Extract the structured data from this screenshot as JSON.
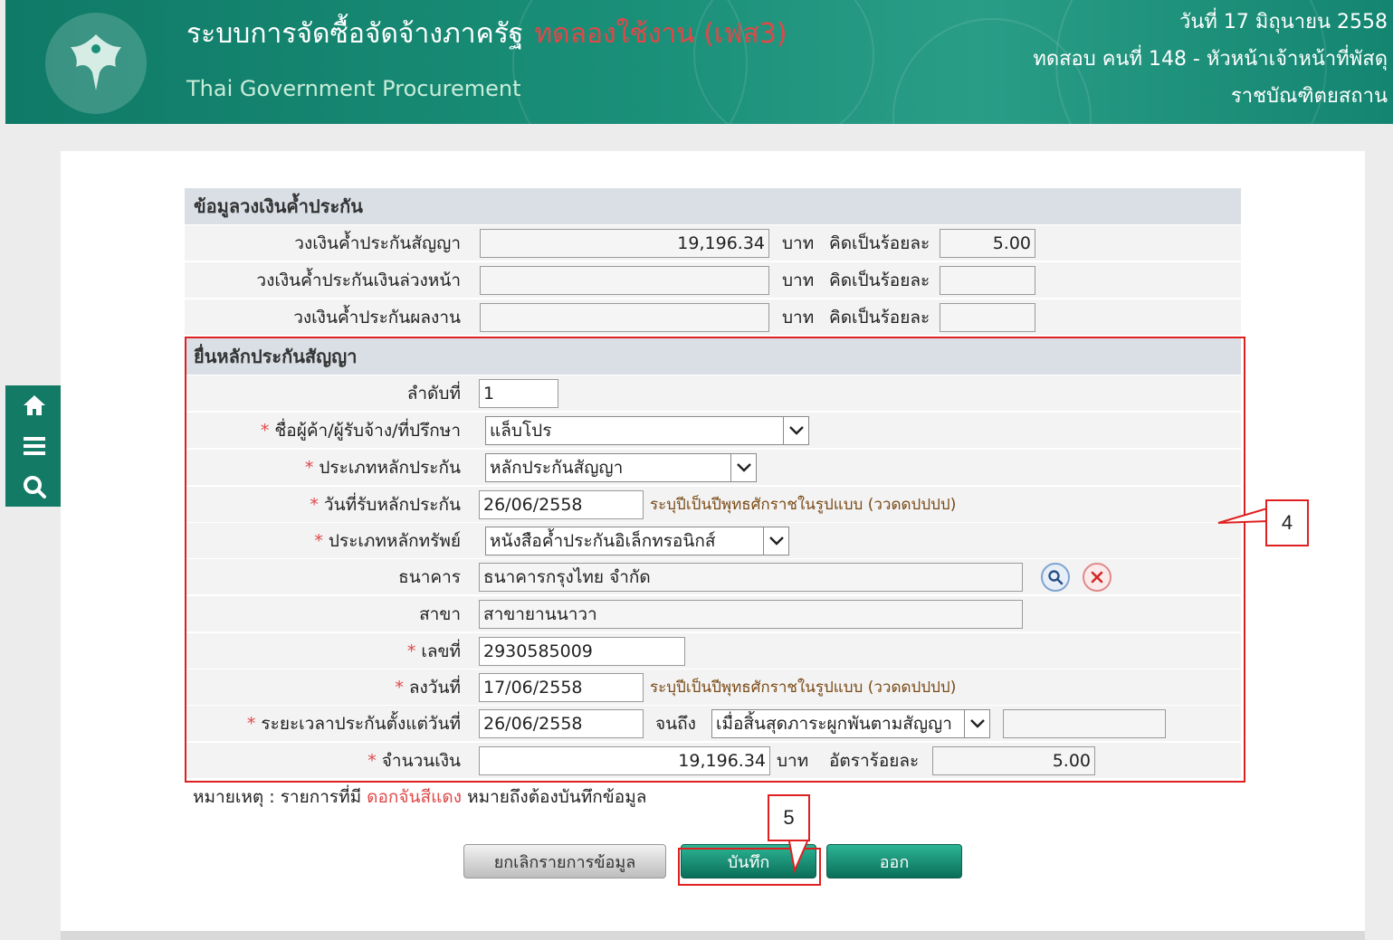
{
  "header": {
    "title": "ระบบการจัดซื้อจัดจ้างภาครัฐ",
    "trial_label": "ทดลองใช้งาน (เฟส3)",
    "subtitle": "Thai Government Procurement",
    "date": "วันที่ 17 มิถุนายน 2558",
    "user": "ทดสอบ คนที่ 148 - หัวหน้าเจ้าหน้าที่พัสดุ",
    "org": "ราชบัณฑิตยสถาน"
  },
  "sidebar": {
    "icons": [
      "home-icon",
      "menu-icon",
      "search-icon"
    ]
  },
  "guarantee_amounts": {
    "heading": "ข้อมูลวงเงินค้ำประกัน",
    "unit": "บาท",
    "percent_label": "คิดเป็นร้อยละ",
    "rows": [
      {
        "label": "วงเงินค้ำประกันสัญญา",
        "amount": "19,196.34",
        "percent": "5.00"
      },
      {
        "label": "วงเงินค้ำประกันเงินล่วงหน้า",
        "amount": "",
        "percent": ""
      },
      {
        "label": "วงเงินค้ำประกันผลงาน",
        "amount": "",
        "percent": ""
      }
    ]
  },
  "contract_guarantee": {
    "heading": "ยื่นหลักประกันสัญญา",
    "seq_label": "ลำดับที่",
    "seq_value": "1",
    "vendor_label": "ชื่อผู้ค้า/ผู้รับจ้าง/ที่ปรึกษา",
    "vendor_value": "แล็บโปร",
    "guarantee_type_label": "ประเภทหลักประกัน",
    "guarantee_type_value": "หลักประกันสัญญา",
    "receive_date_label": "วันที่รับหลักประกัน",
    "receive_date_value": "26/06/2558",
    "date_hint": "ระบุปีเป็นปีพุทธศักราชในรูปแบบ (ววดดปปปป)",
    "asset_type_label": "ประเภทหลักทรัพย์",
    "asset_type_value": "หนังสือค้ำประกันอิเล็กทรอนิกส์",
    "bank_label": "ธนาคาร",
    "bank_value": "ธนาคารกรุงไทย จำกัด",
    "branch_label": "สาขา",
    "branch_value": "สาขายานนาวา",
    "number_label": "เลขที่",
    "number_value": "2930585009",
    "sign_date_label": "ลงวันที่",
    "sign_date_value": "17/06/2558",
    "period_label": "ระยะเวลาประกันตั้งแต่วันที่",
    "period_start": "26/06/2558",
    "until_label": "จนถึง",
    "period_end_value": "เมื่อสิ้นสุดภาระผูกพันตามสัญญา",
    "period_end_extra": "",
    "amount_label": "จำนวนเงิน",
    "amount_value": "19,196.34",
    "unit": "บาท",
    "rate_label": "อัตราร้อยละ",
    "rate_value": "5.00"
  },
  "note": {
    "prefix": "หมายเหตุ : รายการที่มี",
    "red": "ดอกจันสีแดง",
    "suffix": "หมายถึงต้องบันทึกข้อมูล"
  },
  "buttons": {
    "cancel": "ยกเลิกรายการข้อมูล",
    "save": "บันทึก",
    "exit": "ออก"
  },
  "annotations": {
    "box4": "4",
    "box5": "5"
  }
}
